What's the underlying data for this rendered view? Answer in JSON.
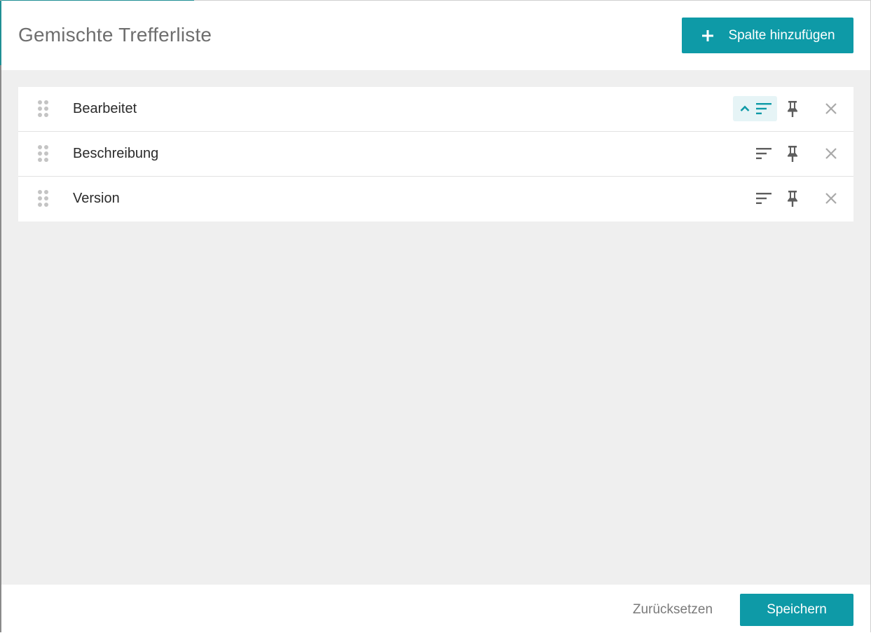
{
  "dialog": {
    "title": "Gemischte Trefferliste"
  },
  "header": {
    "add_column_label": "Spalte hinzufügen",
    "add_icon": "plus-icon"
  },
  "columns": [
    {
      "label": "Bearbeitet",
      "sort": "ascending",
      "sort_active": true,
      "pinned": false
    },
    {
      "label": "Beschreibung",
      "sort": "none",
      "sort_active": false,
      "pinned": false
    },
    {
      "label": "Version",
      "sort": "none",
      "sort_active": false,
      "pinned": false
    }
  ],
  "row_icons": {
    "drag": "drag-handle-icon",
    "sort": "sort-icon",
    "pin": "pin-icon",
    "remove": "close-icon"
  },
  "footer": {
    "reset_label": "Zurücksetzen",
    "save_label": "Speichern"
  },
  "colors": {
    "accent": "#0e9aa7",
    "active_sort_bg": "#e6f4f6",
    "panel_bg": "#efefef"
  }
}
